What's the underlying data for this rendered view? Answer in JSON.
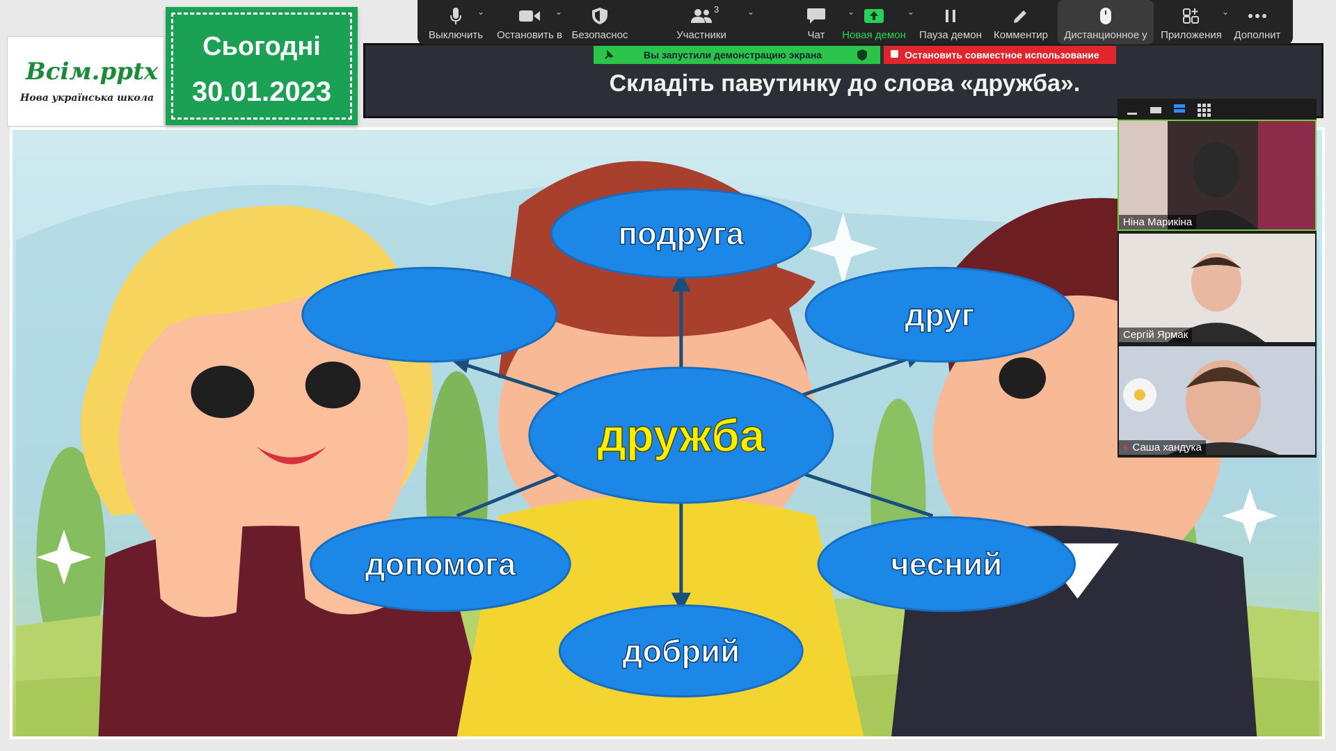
{
  "toolbar": {
    "items": [
      {
        "label": "Выключить",
        "icon": "microphone-icon"
      },
      {
        "label": "Остановить в",
        "icon": "video-camera-icon"
      },
      {
        "label": "Безопаснос",
        "icon": "shield-icon"
      },
      {
        "label": "Участники",
        "icon": "participants-icon",
        "count": "3"
      },
      {
        "label": "Чат",
        "icon": "chat-icon"
      },
      {
        "label": "Новая демон",
        "icon": "share-screen-icon"
      },
      {
        "label": "Пауза демон",
        "icon": "pause-icon"
      },
      {
        "label": "Комментир",
        "icon": "pencil-icon"
      },
      {
        "label": "Дистанционное у",
        "icon": "remote-control-icon"
      },
      {
        "label": "Приложения",
        "icon": "apps-icon"
      },
      {
        "label": "Дополнит",
        "icon": "more-icon"
      }
    ]
  },
  "share": {
    "status": "Вы запустили демонстрацию экрана",
    "stop": "Остановить совместное использование"
  },
  "slide": {
    "logo_main": "Всім.pptx",
    "logo_sub": "Нова українська школа",
    "date_line1": "Сьогодні",
    "date_line2": "30.01.2023",
    "title": "Складіть павутинку до слова «дружба».",
    "center_word": "дружба",
    "words": {
      "top": "подруга",
      "top_left": "",
      "top_right": "друг",
      "bottom_left": "допомога",
      "bottom_right": "чесний",
      "bottom": "добрий"
    }
  },
  "participants": [
    {
      "name": "Ніна Марикіна",
      "muted": false,
      "speaking": true
    },
    {
      "name": "Сергій Ярмак",
      "muted": false,
      "speaking": false
    },
    {
      "name": "Саша хандука",
      "muted": true,
      "speaking": false
    }
  ],
  "colors": {
    "green": "#1aa154",
    "ellipse": "#1c87e6",
    "center_text": "#ffee00",
    "stop_red": "#e0252d",
    "share_green": "#2ac44b"
  }
}
